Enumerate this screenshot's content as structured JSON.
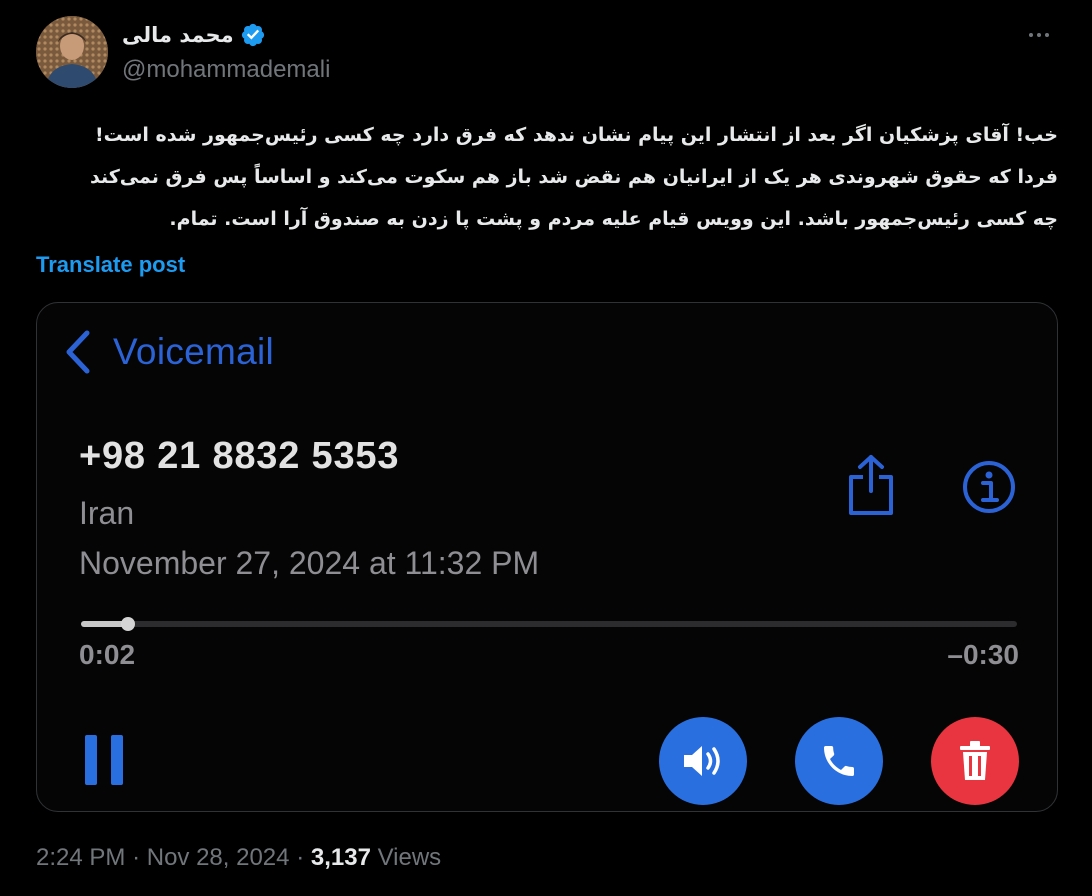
{
  "author": {
    "display_name": "محمد مالی",
    "handle": "@mohammademali",
    "verified": true,
    "verified_color": "#1d9bf0"
  },
  "tweet": {
    "lines": [
      "خب! آقای پزشکیان اگر بعد از انتشار این پیام نشان ندهد که فرق دارد چه کسی رئیس‌جمهور شده است!",
      "فردا که حقوق شهروندی هر یک از ایرانیان هم نقض شد باز هم سکوت می‌کند و اساساً پس فرق نمی‌کند",
      "چه کسی رئیس‌جمهور باشد. این وویس قیام علیه مردم و پشت پا زدن به صندوق آرا است. تمام."
    ],
    "translate_label": "Translate post"
  },
  "voicemail": {
    "back_label": "Voicemail",
    "phone_number": "+98 21 8832 5353",
    "location": "Iran",
    "datetime": "November 27, 2024 at 11:32 PM",
    "elapsed": "0:02",
    "remaining": "–0:30",
    "progress_fraction": 0.05,
    "accent_color": "#2a6fe0",
    "delete_color": "#e8353f",
    "icons": {
      "back": "chevron-left-icon",
      "share": "share-icon",
      "info": "info-icon",
      "pause": "pause-icon",
      "speaker": "speaker-icon",
      "call": "phone-icon",
      "delete": "trash-icon"
    }
  },
  "meta": {
    "time": "2:24 PM",
    "separator": "·",
    "date": "Nov 28, 2024",
    "views_count": "3,137",
    "views_label": "Views"
  }
}
